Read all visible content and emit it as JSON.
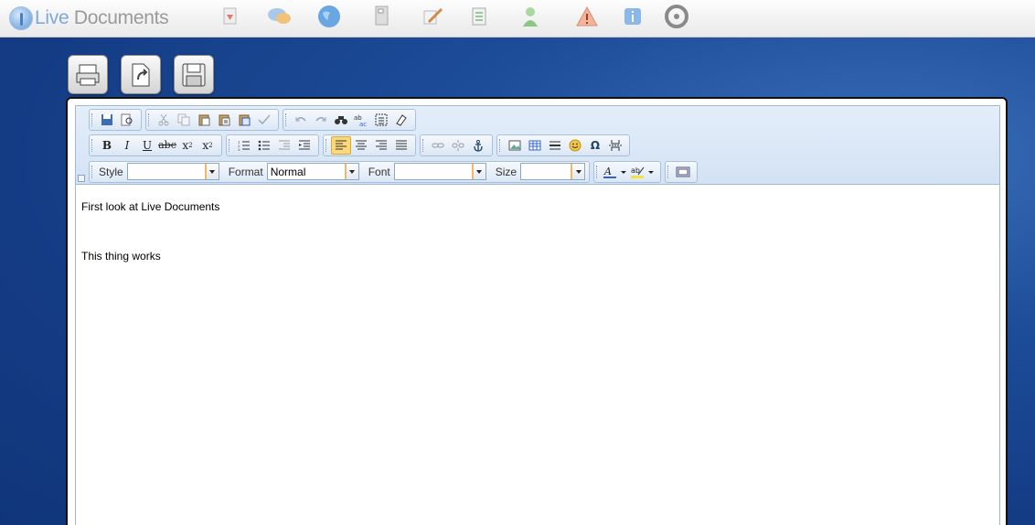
{
  "app": {
    "logo_text_live": "Live",
    "logo_text_rest": " Documents"
  },
  "top_icons": [
    "new-document-icon",
    "chat-bubbles-icon",
    "globe-icon",
    "documents-icon",
    "edit-pencil-icon",
    "checklist-icon",
    "user-icon",
    "warning-icon",
    "info-icon",
    "settings-icon"
  ],
  "action_buttons": [
    "print-icon",
    "export-document-icon",
    "save-disk-icon"
  ],
  "toolbar": {
    "style_label": "Style",
    "style_value": "",
    "format_label": "Format",
    "format_value": "Normal",
    "font_label": "Font",
    "font_value": "",
    "size_label": "Size",
    "size_value": "",
    "bold": "B",
    "italic": "I",
    "underline": "U",
    "strike": "abc",
    "subscript": "x",
    "superscript": "x",
    "omega": "Ω"
  },
  "document": {
    "line1": "First look at Live Documents",
    "line2": "This thing works"
  },
  "colors": {
    "background": "#143c85",
    "toolbar": "#d3e2f4",
    "active": "#fbd97a"
  }
}
